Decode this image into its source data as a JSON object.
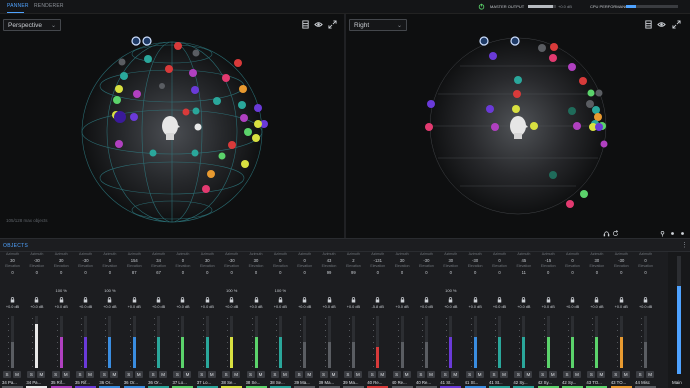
{
  "topbar": {
    "tabs": [
      {
        "label": "PANNER",
        "active": true
      },
      {
        "label": "RENDERER",
        "active": false
      }
    ],
    "master_output_label": "MASTER OUTPUT",
    "master_output_value": "+0.0 dB",
    "master_output_level": 0.9,
    "cpu_label": "CPU PERFORMANCE",
    "cpu_level": 0.2
  },
  "viewports": {
    "left": {
      "view": "Perspective",
      "object_count": "105/128 max objects"
    },
    "right": {
      "view": "Right"
    }
  },
  "colors": {
    "accent": "#4fa3ff",
    "gray": "#5a5d62",
    "white": "#e8e8e8",
    "magenta": "#b040c0",
    "violet": "#6a3ad8",
    "blue": "#3a8de0",
    "teal": "#2aa79b",
    "green": "#5bd36b",
    "yellow": "#d8e040",
    "orange": "#e89a30",
    "red": "#d83a3a",
    "pink": "#e23a70"
  },
  "objects": {
    "title": "OBJECTS",
    "labels": {
      "azimuth": "Azimuth",
      "elevation": "Elevation",
      "s": "S",
      "m": "M"
    },
    "strips": [
      {
        "azimuth": "30",
        "elevation": "0",
        "distance": "",
        "gain": "+0.0 dB",
        "name": "34 Pa...",
        "color": "gray",
        "level": 0.5
      },
      {
        "azimuth": "-30",
        "elevation": "0",
        "distance": "",
        "gain": "+0.0 dB",
        "name": "34 Pa...",
        "color": "white",
        "level": 0.85
      },
      {
        "azimuth": "30",
        "elevation": "0",
        "distance": "100 %",
        "gain": "+0.0 dB",
        "name": "35 Rif...",
        "color": "magenta",
        "level": 0.6
      },
      {
        "azimuth": "-30",
        "elevation": "0",
        "distance": "",
        "gain": "+0.0 dB",
        "name": "35 Rif...",
        "color": "violet",
        "level": 0.6
      },
      {
        "azimuth": "0",
        "elevation": "0",
        "distance": "100 %",
        "gain": "+0.0 dB",
        "name": "36 Or...",
        "color": "blue",
        "level": 0.6
      },
      {
        "azimuth": "154",
        "elevation": "87",
        "distance": "",
        "gain": "+0.0 dB",
        "name": "36 Or...",
        "color": "blue",
        "level": 0.6
      },
      {
        "azimuth": "34",
        "elevation": "67",
        "distance": "",
        "gain": "+0.0 dB",
        "name": "36 Or...",
        "color": "teal",
        "level": 0.6
      },
      {
        "azimuth": "0",
        "elevation": "0",
        "distance": "",
        "gain": "+0.0 dB",
        "name": "37 Lo...",
        "color": "green",
        "level": 0.6
      },
      {
        "azimuth": "30",
        "elevation": "0",
        "distance": "",
        "gain": "+0.0 dB",
        "name": "37 Lo...",
        "color": "teal",
        "level": 0.6
      },
      {
        "azimuth": "-30",
        "elevation": "0",
        "distance": "100 %",
        "gain": "+0.0 dB",
        "name": "38 Se...",
        "color": "yellow",
        "level": 0.6
      },
      {
        "azimuth": "30",
        "elevation": "0",
        "distance": "",
        "gain": "+0.0 dB",
        "name": "38 Se...",
        "color": "green",
        "level": 0.6
      },
      {
        "azimuth": "0",
        "elevation": "0",
        "distance": "100 %",
        "gain": "+0.0 dB",
        "name": "38 Se...",
        "color": "teal",
        "level": 0.6
      },
      {
        "azimuth": "0",
        "elevation": "0",
        "distance": "",
        "gain": "+0.0 dB",
        "name": "39 Ma...",
        "color": "gray",
        "level": 0.5
      },
      {
        "azimuth": "43",
        "elevation": "99",
        "distance": "",
        "gain": "+0.0 dB",
        "name": "39 Ma...",
        "color": "gray",
        "level": 0.5
      },
      {
        "azimuth": "2",
        "elevation": "99",
        "distance": "",
        "gain": "+0.0 dB",
        "name": "39 Ma...",
        "color": "gray",
        "level": 0.5
      },
      {
        "azimuth": "-131",
        "elevation": "0",
        "distance": "",
        "gain": "-5.8 dB",
        "name": "40 Re...",
        "color": "red",
        "level": 0.4
      },
      {
        "azimuth": "30",
        "elevation": "0",
        "distance": "",
        "gain": "+0.0 dB",
        "name": "40 Re...",
        "color": "gray",
        "level": 0.5
      },
      {
        "azimuth": "-30",
        "elevation": "0",
        "distance": "",
        "gain": "+0.0 dB",
        "name": "40 Re...",
        "color": "gray",
        "level": 0.5
      },
      {
        "azimuth": "30",
        "elevation": "0",
        "distance": "100 %",
        "gain": "+0.0 dB",
        "name": "41 St...",
        "color": "violet",
        "level": 0.6
      },
      {
        "azimuth": "-30",
        "elevation": "0",
        "distance": "",
        "gain": "+0.0 dB",
        "name": "41 St...",
        "color": "blue",
        "level": 0.6
      },
      {
        "azimuth": "0",
        "elevation": "0",
        "distance": "",
        "gain": "+0.0 dB",
        "name": "41 St...",
        "color": "teal",
        "level": 0.6
      },
      {
        "azimuth": "45",
        "elevation": "11",
        "distance": "",
        "gain": "+0.0 dB",
        "name": "42 Sy...",
        "color": "teal",
        "level": 0.6
      },
      {
        "azimuth": "-15",
        "elevation": "0",
        "distance": "",
        "gain": "+0.0 dB",
        "name": "42 Sy...",
        "color": "green",
        "level": 0.6
      },
      {
        "azimuth": "0",
        "elevation": "0",
        "distance": "",
        "gain": "+0.0 dB",
        "name": "42 Sy...",
        "color": "green",
        "level": 0.6
      },
      {
        "azimuth": "30",
        "elevation": "0",
        "distance": "",
        "gain": "+0.0 dB",
        "name": "43 TO...",
        "color": "green",
        "level": 0.6
      },
      {
        "azimuth": "-30",
        "elevation": "0",
        "distance": "",
        "gain": "+0.0 dB",
        "name": "43 TO...",
        "color": "orange",
        "level": 0.6
      },
      {
        "azimuth": "0",
        "elevation": "0",
        "distance": "",
        "gain": "+0.0 dB",
        "name": "44 Misc",
        "color": "gray",
        "level": 0.5
      }
    ],
    "main": {
      "name": "Main",
      "level": 0.75
    }
  }
}
